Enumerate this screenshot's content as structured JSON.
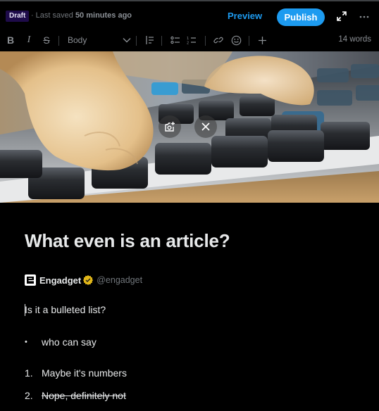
{
  "header": {
    "status_badge": "Draft",
    "saved_prefix": "Last saved",
    "saved_time": "50 minutes ago",
    "preview_label": "Preview",
    "publish_label": "Publish",
    "expand_icon": "expand-arrows-icon",
    "more_icon": "more-horizontal-icon"
  },
  "toolbar": {
    "bold_label": "B",
    "italic_label": "I",
    "strike_label": "S",
    "block_style": "Body",
    "icons": [
      "bold-icon",
      "italic-icon",
      "strikethrough-icon",
      "chevron-down-icon",
      "blockquote-icon",
      "bulleted-list-icon",
      "numbered-list-icon",
      "link-icon",
      "emoji-icon",
      "insert-plus-icon"
    ],
    "word_count": "14 words"
  },
  "hero_image": {
    "description": "Cat paws resting on a computer keyboard",
    "actions": {
      "edit_icon": "add-photo-icon",
      "remove_icon": "close-icon"
    }
  },
  "article": {
    "title": "What even is an article?",
    "author": {
      "name": "Engadget",
      "handle": "@engadget",
      "verified_color": "#e2b719"
    },
    "paragraph": "Is it a bulleted list?",
    "bullets": [
      {
        "marker": "•",
        "text": "who can say"
      }
    ],
    "numbered": [
      {
        "marker": "1.",
        "text": "Maybe it's numbers",
        "strikethrough": false
      },
      {
        "marker": "2.",
        "text": "Nope, definitely not",
        "strikethrough": true
      }
    ]
  },
  "colors": {
    "accent": "#1d9bf0",
    "background": "#000000",
    "draft_badge_bg": "#1e0b4a",
    "muted_text": "#71767b"
  }
}
